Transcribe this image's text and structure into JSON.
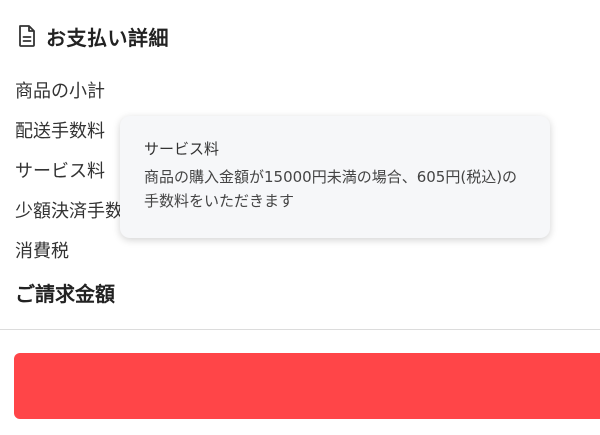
{
  "section": {
    "title": "お支払い詳細",
    "icon": "document-icon"
  },
  "rows": [
    {
      "label": "商品の小計"
    },
    {
      "label": "配送手数料"
    },
    {
      "label": "サービス料"
    },
    {
      "label": "少額決済手数料"
    },
    {
      "label": "消費税"
    }
  ],
  "total": {
    "label": "ご請求金額"
  },
  "tooltip": {
    "title": "サービス料",
    "body": "商品の購入金額が15000円未満の場合、605円(税込)の手数料をいただきます"
  },
  "colors": {
    "button": "#ff4548",
    "tooltip_bg": "#f6f7f9"
  }
}
